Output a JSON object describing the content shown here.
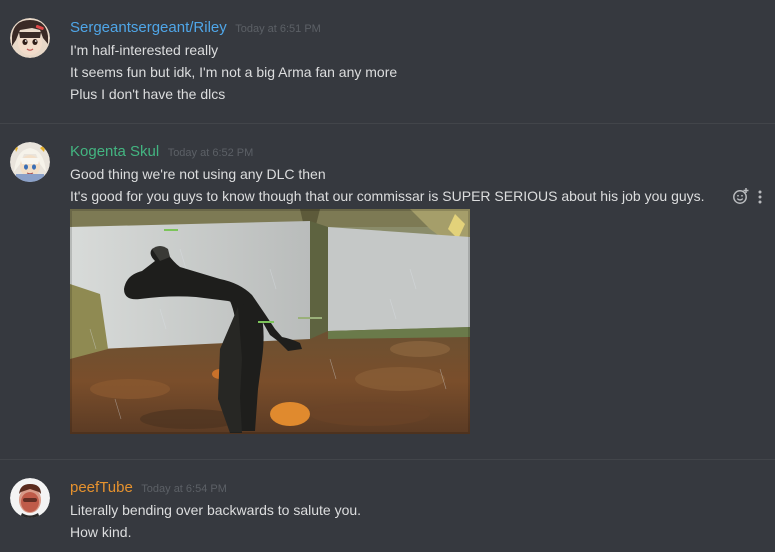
{
  "messages": [
    {
      "username": "Sergeantsergeant/Riley",
      "username_color": "#4fa6e8",
      "timestamp": "Today at 6:51 PM",
      "avatar_icon": "anime-girl-avatar-icon",
      "lines": [
        "I'm half-interested really",
        "It seems fun but idk, I'm not a big Arma fan any more",
        "Plus I don't have the dlcs"
      ]
    },
    {
      "username": "Kogenta Skul",
      "username_color": "#43b581",
      "timestamp": "Today at 6:52 PM",
      "avatar_icon": "anime-character-avatar-icon",
      "lines": [
        "Good thing we're not using any DLC then",
        "It's good for you guys to know though that our commissar is SUPER SERIOUS about his job you guys."
      ],
      "attachment_icon": "game-screenshot-image"
    },
    {
      "username": "peefTube",
      "username_color": "#e6922e",
      "timestamp": "Today at 6:54 PM",
      "avatar_icon": "photo-avatar-icon",
      "lines": [
        "Literally bending over backwards to salute you.",
        "How kind."
      ]
    }
  ],
  "hover_actions": {
    "reaction_icon": "add-reaction-icon",
    "more_icon": "more-options-icon"
  },
  "colors": {
    "background": "#36393f",
    "text": "#dcddde",
    "timestamp": "#5c6066"
  }
}
